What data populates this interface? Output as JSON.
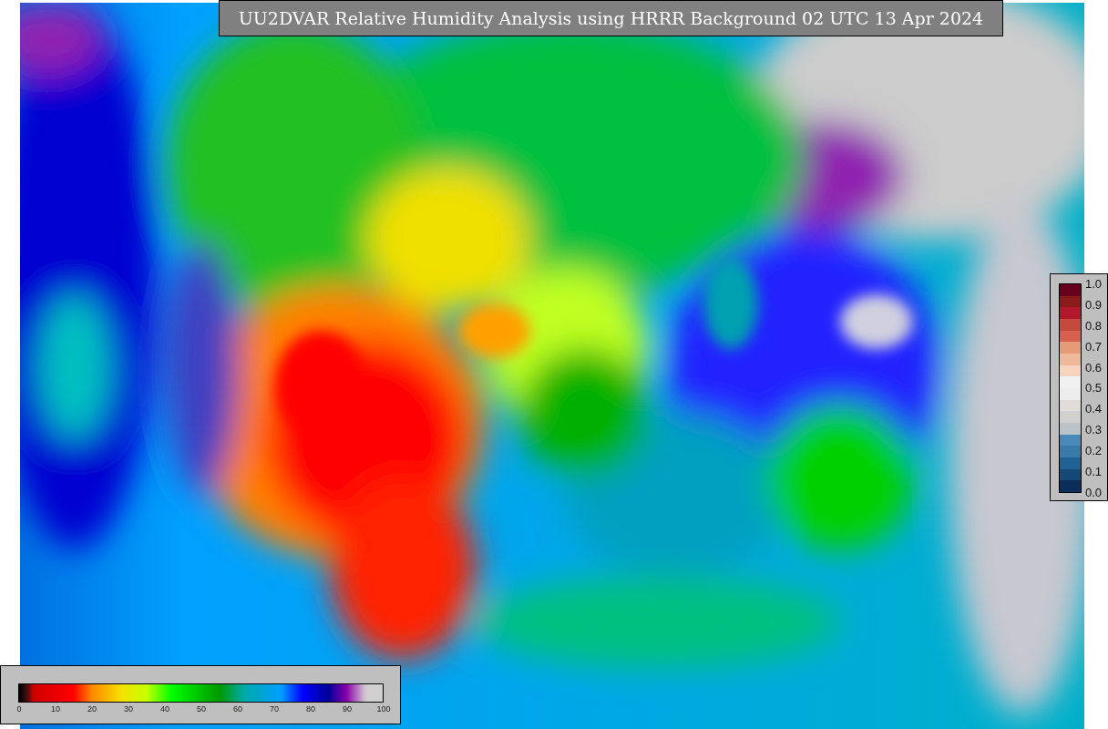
{
  "title": "UU2DVAR Relative Humidity Analysis using HRRR Background 02 UTC 13 Apr 2024",
  "humidity_colorbar": {
    "ticks": [
      "0",
      "10",
      "20",
      "30",
      "40",
      "50",
      "60",
      "70",
      "80",
      "90",
      "100"
    ]
  },
  "ratio_colorbar": {
    "ticks": [
      "1.0",
      "0.9",
      "0.8",
      "0.7",
      "0.6",
      "0.5",
      "0.4",
      "0.3",
      "0.2",
      "0.1",
      "0.0"
    ]
  }
}
